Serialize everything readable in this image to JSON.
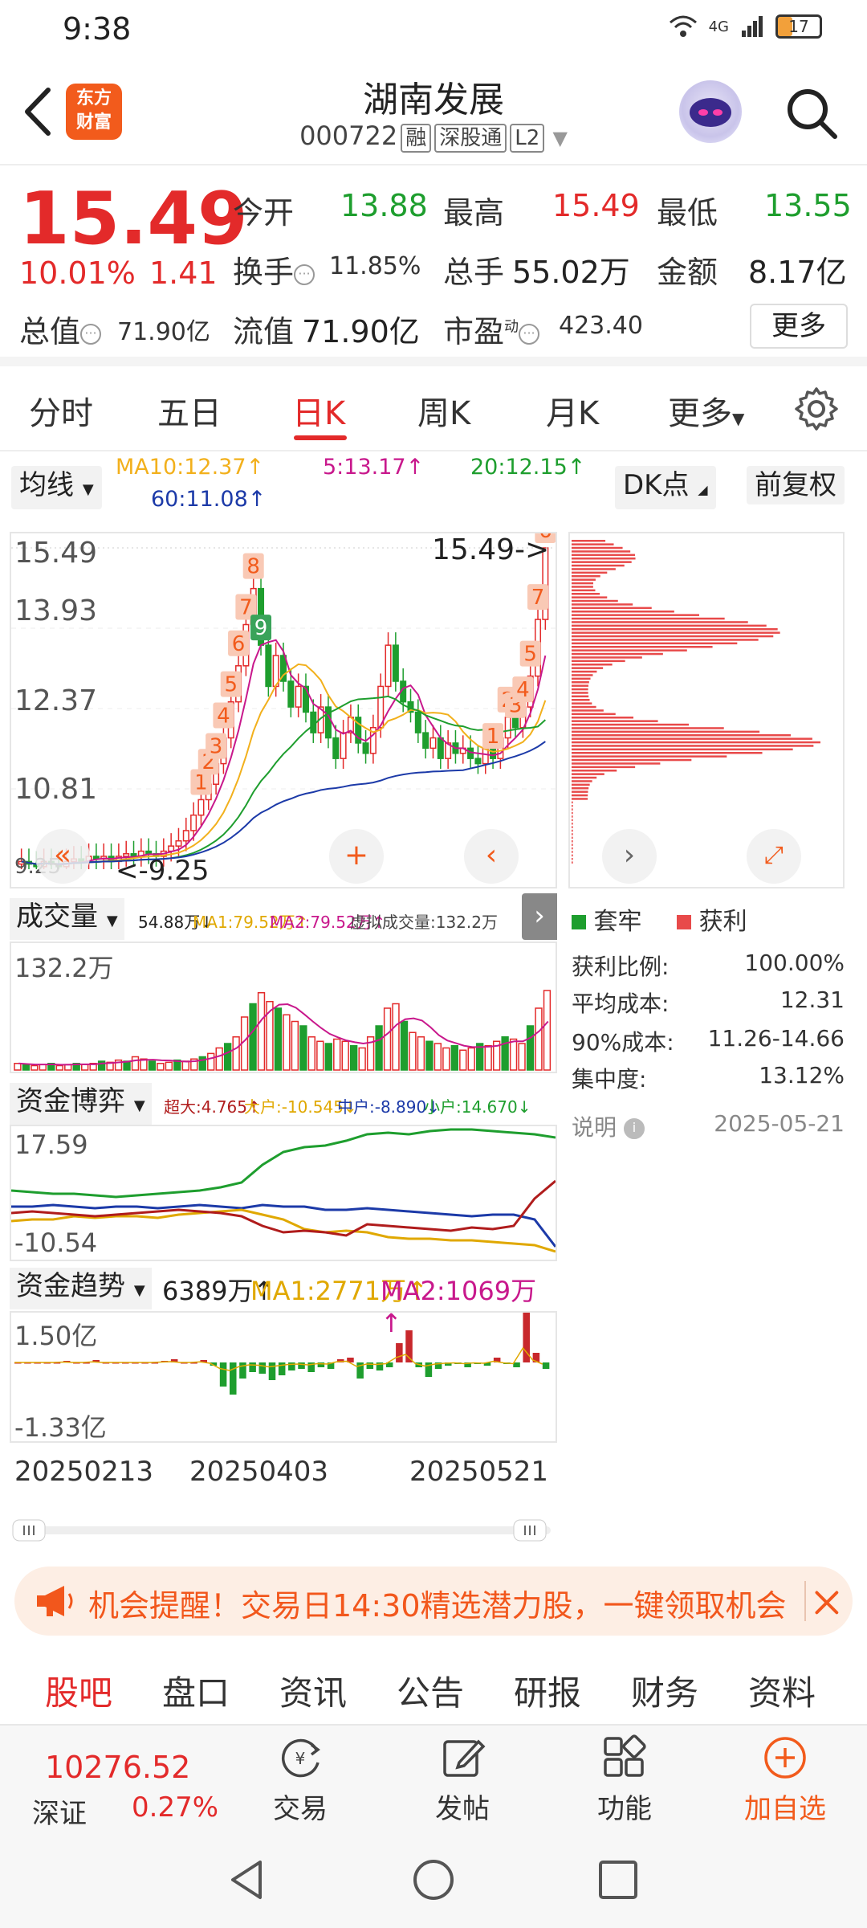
{
  "status_bar": {
    "time": "9:38",
    "network": "4G",
    "battery": "17"
  },
  "header": {
    "logo_line1": "东方",
    "logo_line2": "财富",
    "stock_name": "湖南发展",
    "stock_code": "000722",
    "tags": [
      "融",
      "深股通",
      "L2"
    ]
  },
  "quote": {
    "price": "15.49",
    "pct": "10.01%",
    "change": "1.41",
    "open_label": "今开",
    "open": "13.88",
    "high_label": "最高",
    "high": "15.49",
    "low_label": "最低",
    "low": "13.55",
    "turnover_label": "换手",
    "turnover": "11.85%",
    "volume_label": "总手",
    "volume": "55.02万",
    "amount_label": "金额",
    "amount": "8.17亿",
    "mcap_label": "总值",
    "mcap": "71.90亿",
    "float_label": "流值",
    "float": "71.90亿",
    "pe_label": "市盈",
    "pe_sup": "动",
    "pe": "423.40",
    "more": "更多"
  },
  "tabs": [
    "分时",
    "五日",
    "日K",
    "周K",
    "月K",
    "更多"
  ],
  "ma": {
    "selector": "均线",
    "ma10": "MA10:12.37↑",
    "ma5": "5:13.17↑",
    "ma20": "20:12.15↑",
    "ma60": "60:11.08↑",
    "dk": "DK点",
    "adjust": "前复权"
  },
  "kchart": {
    "y_ticks": [
      "15.49",
      "13.93",
      "12.37",
      "10.81",
      "9.25"
    ],
    "last_label": "15.49->",
    "low_label": "<-9.25",
    "signal_numbers": [
      "1",
      "2",
      "3",
      "4",
      "5",
      "6",
      "7",
      "8",
      "9",
      "1",
      "2",
      "3",
      "4",
      "5",
      "6",
      "7"
    ]
  },
  "chart_data": {
    "type": "candlestick",
    "title": "",
    "ylim": [
      9.25,
      15.49
    ],
    "x_ticks": [
      "20250213",
      "20250403",
      "20250521"
    ],
    "last_close": 15.49,
    "high": 15.49,
    "low": 9.25,
    "moving_averages": [
      {
        "name": "MA5",
        "value": 13.17,
        "color": "#c8188c"
      },
      {
        "name": "MA10",
        "value": 12.37,
        "color": "#f2b01c"
      },
      {
        "name": "MA20",
        "value": 12.15,
        "color": "#1e9e2e"
      },
      {
        "name": "MA60",
        "value": 11.08,
        "color": "#1c3aa8"
      }
    ]
  },
  "volume": {
    "title": "成交量",
    "v": "54.88万↓",
    "ma1": "MA1:79.52万↑",
    "ma2": "MA2:79.52万↑",
    "virtual": "虚拟成交量:132.2万",
    "y_max": "132.2万"
  },
  "fund_game": {
    "title": "资金博弈",
    "super": "超大:4.765↑",
    "big": "大户:-10.545↓",
    "mid": "中户:-8.890↓",
    "small": "小户:14.670↓",
    "y_max": "17.59",
    "y_min": "-10.54"
  },
  "fund_trend": {
    "title": "资金趋势",
    "value": "6389万↑",
    "ma1": "MA1:2771万↑",
    "ma2": "MA2:1069万↑",
    "y_max": "1.50亿",
    "y_min": "-1.33亿"
  },
  "chips": {
    "legend_hold": "套牢",
    "legend_profit": "获利",
    "profit_ratio_label": "获利比例:",
    "profit_ratio": "100.00%",
    "avg_cost_label": "平均成本:",
    "avg_cost": "12.31",
    "cost90_label": "90%成本:",
    "cost90": "11.26-14.66",
    "concentration_label": "集中度:",
    "concentration": "13.12%",
    "note_label": "说明",
    "date": "2025-05-21"
  },
  "banner": {
    "text": "机会提醒！交易日14:30精选潜力股，一键领取机会"
  },
  "section_tabs": [
    "股吧",
    "盘口",
    "资讯",
    "公告",
    "研报",
    "财务",
    "资料"
  ],
  "toolbar": {
    "index_value": "10276.52",
    "index_name": "深证",
    "index_pct": "0.27%",
    "trade": "交易",
    "post": "发帖",
    "func": "功能",
    "add": "加自选"
  },
  "colors": {
    "up": "#e32a2a",
    "down": "#1e9e2e",
    "accent": "#f25b1c"
  }
}
